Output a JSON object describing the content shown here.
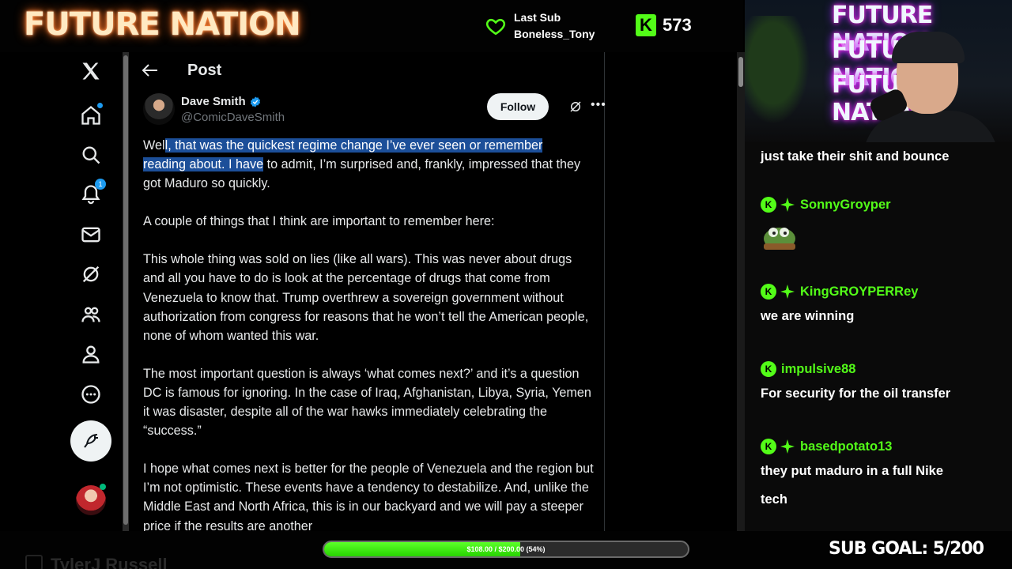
{
  "stream": {
    "brand": "FUTURE NATION",
    "last_sub_label": "Last Sub",
    "last_sub_name": "Boneless_Tony",
    "viewer_count": "573",
    "sub_goal_text": "SUB GOAL: 5/200",
    "donation_bar_text": "$108.00 / $200.00 (54%)",
    "donation_progress": 0.54,
    "ghost_name": "TylerJ Russell",
    "colors": {
      "kick_green": "#53fc18",
      "twitter_blue": "#1d9bf0",
      "highlight": "#1c4f99"
    }
  },
  "webcam": {
    "neon_lines": [
      "FUTURE NATION",
      "FUTURE NATION",
      "FUTURE NATION"
    ]
  },
  "x": {
    "nav": [
      {
        "name": "x-logo-icon"
      },
      {
        "name": "home-icon"
      },
      {
        "name": "explore-icon"
      },
      {
        "name": "notifications-icon",
        "badge": "1"
      },
      {
        "name": "messages-icon"
      },
      {
        "name": "grok-icon"
      },
      {
        "name": "communities-icon"
      },
      {
        "name": "profile-icon"
      },
      {
        "name": "more-icon"
      }
    ],
    "header_title": "Post",
    "author": {
      "name": "Dave Smith",
      "handle": "@ComicDaveSmith",
      "follow_label": "Follow"
    },
    "tweet": {
      "p1_hl1": "l, that was the quickest regime change I’ve ever seen or remember",
      "p1_pre": "Wel",
      "p1_hl2": "reading about. I have",
      "p1_rest": " to admit, I’m surprised and, frankly, impressed that they got Maduro so quickly.",
      "p2": "A couple of things that I think are important to remember here:",
      "p3": "This whole thing was sold on lies (like all wars). This was never about drugs and all you have to do is look at the percentage of drugs that come from Venezuela to know that. Trump overthrew a sovereign government without authorization from congress for reasons that he won’t tell the American people, none of whom wanted this war.",
      "p4": "The most important question is always ‘what comes next?’ and it’s a question DC is famous for ignoring. In the case of Iraq, Afghanistan, Libya, Syria, Yemen it was disaster, despite all of the war hawks immediately celebrating the “success.”",
      "p5": "I hope what comes next is better for the people of Venezuela and the region but I’m not optimistic. These events have a tendency to destabilize. And, unlike the Middle East and North Africa, this is in our backyard and we will pay a steeper price if the results are another"
    }
  },
  "chat": {
    "partial_top": "just take their shit and bounce",
    "messages": [
      {
        "user": "SonnyGroyper",
        "text": "",
        "emote": "pepe-emote"
      },
      {
        "user": "KingGROYPERRey",
        "text": "we are winning"
      },
      {
        "user": "impulsive88",
        "text": "For security for the oil transfer"
      },
      {
        "user": "basedpotato13",
        "text_line1": "they put maduro in a full Nike",
        "text_line2": "tech"
      }
    ]
  }
}
